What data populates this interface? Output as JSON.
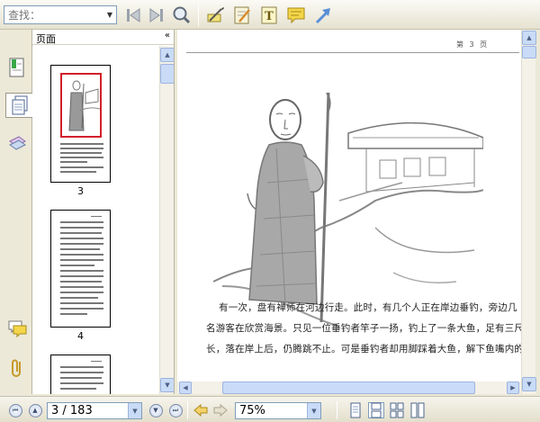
{
  "toolbar": {
    "search_placeholder": "查找：",
    "icons": [
      "prev-result-icon",
      "next-result-icon",
      "find-icon",
      "select-text-icon",
      "note-icon",
      "text-box-icon",
      "comment-icon",
      "arrow-icon"
    ]
  },
  "left_panel": {
    "title": "页面",
    "collapse_glyph": "«",
    "thumbnails": [
      {
        "label": "3"
      },
      {
        "label": "4"
      },
      {
        "label": ""
      }
    ]
  },
  "document": {
    "page_header": "第 3 页",
    "paragraph_lines": [
      "有一次，盘有禅师在河边行走。此时，有几个人正在岸边垂钓，旁边几",
      "名游客在欣赏海景。只见一位垂钓者竿子一扬，钓上了一条大鱼，足有三尺",
      "长，落在岸上后，仍腾跳不止。可是垂钓者却用脚踩着大鱼，解下鱼嘴内的"
    ]
  },
  "statusbar": {
    "page_indicator": "3 / 183",
    "zoom": "75%"
  }
}
